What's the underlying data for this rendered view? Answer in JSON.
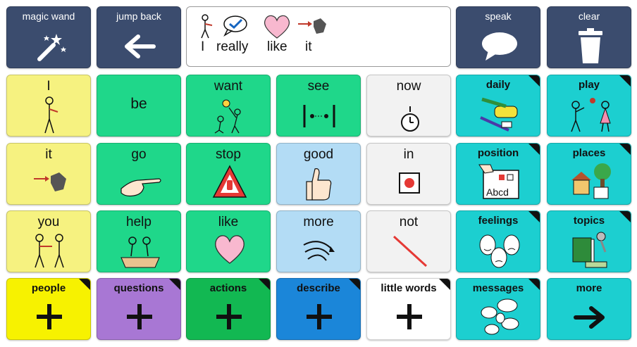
{
  "nav": {
    "magic_wand": "magic wand",
    "jump_back": "jump back",
    "speak": "speak",
    "clear": "clear"
  },
  "message_bar": {
    "words": [
      "I",
      "really",
      "like",
      "it"
    ]
  },
  "grid": {
    "row1": {
      "c1": "I",
      "c2": "be",
      "c3": "want",
      "c4": "see",
      "c5": "now",
      "c6": "daily",
      "c7": "play"
    },
    "row2": {
      "c1": "it",
      "c2": "go",
      "c3": "stop",
      "c4": "good",
      "c5": "in",
      "c6": "position",
      "c7": "places"
    },
    "row3": {
      "c1": "you",
      "c2": "help",
      "c3": "like",
      "c4": "more",
      "c5": "not",
      "c6": "feelings",
      "c7": "topics"
    },
    "row4": {
      "c1": "people",
      "c2": "questions",
      "c3": "actions",
      "c4": "describe",
      "c5": "little words",
      "c6": "messages",
      "c7": "more"
    }
  },
  "colors": {
    "nav": "#3b4c6e",
    "pronoun_yellow": "#f6f280",
    "verb_green": "#1fd78a",
    "describe_blue": "#b3dcf5",
    "little_gray": "#f2f2f2",
    "topic_teal": "#1ccfd0",
    "people_folder": "#f7f200",
    "questions_folder": "#a877d4",
    "actions_folder": "#12b852",
    "describe_folder": "#1b86d9",
    "little_words_folder": "#ffffff"
  },
  "icons": [
    "magic-wand-icon",
    "arrow-left-icon",
    "speech-bubble-icon",
    "trash-bin-icon",
    "plus-icon",
    "arrow-right-icon",
    "heart-icon",
    "thumbs-up-icon",
    "stop-sign-icon",
    "stopwatch-icon",
    "pointing-hand-icon"
  ]
}
